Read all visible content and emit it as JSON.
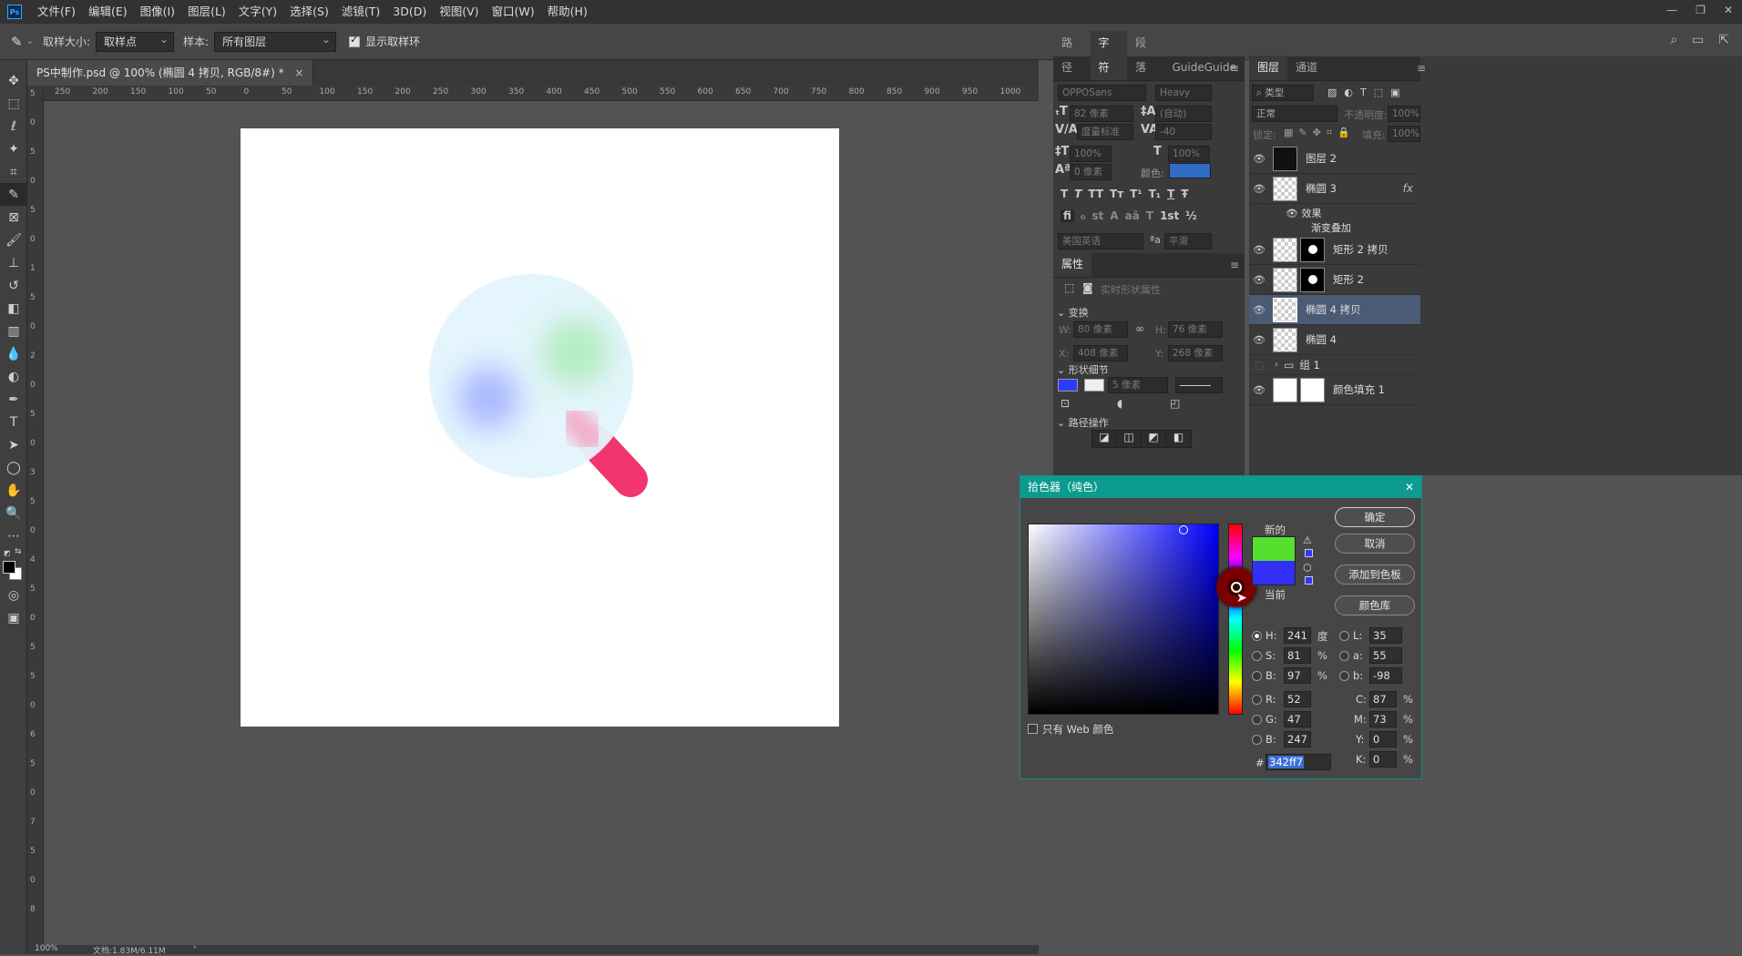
{
  "app": {
    "icon": "Ps"
  },
  "menu": [
    "文件(F)",
    "编辑(E)",
    "图像(I)",
    "图层(L)",
    "文字(Y)",
    "选择(S)",
    "滤镜(T)",
    "3D(D)",
    "视图(V)",
    "窗口(W)",
    "帮助(H)"
  ],
  "options": {
    "sample_size_label": "取样大小:",
    "sample_size_value": "取样点",
    "sample_label": "样本:",
    "sample_value": "所有图层",
    "show_ring_label": "显示取样环"
  },
  "document": {
    "tab_title": "PS中制作.psd @ 100% (椭圆 4 拷贝, RGB/8#) *",
    "close": "×"
  },
  "ruler_h": [
    "250",
    "200",
    "150",
    "100",
    "50",
    "0",
    "50",
    "100",
    "150",
    "200",
    "250",
    "300",
    "350",
    "400",
    "450",
    "500",
    "550",
    "600",
    "650",
    "700",
    "750",
    "800",
    "850",
    "900",
    "950",
    "1000",
    "1050"
  ],
  "ruler_v": [
    "5",
    "0",
    "5",
    "0",
    "5",
    "0",
    "1",
    "5",
    "0",
    "2",
    "0",
    "5",
    "0",
    "3",
    "5",
    "0",
    "4",
    "5",
    "0",
    "5",
    "5",
    "0",
    "6",
    "5",
    "0",
    "7",
    "5",
    "0",
    "8"
  ],
  "status": {
    "zoom": "100%",
    "doc": "文档:1.83M/6.11M",
    "arrow": "›"
  },
  "char_panel": {
    "tabs": [
      "路径",
      "字符",
      "段落",
      "GuideGuide"
    ],
    "font_family": "OPPOSans",
    "font_style": "Heavy",
    "font_size": "82 像素",
    "leading": "(自动)",
    "kerning": "度量标准",
    "tracking": "-40",
    "v_scale": "100%",
    "h_scale": "100%",
    "baseline": "0 像素",
    "color_label": "颜色:",
    "color": "#2f6bc2",
    "style_buttons": [
      "T",
      "T",
      "TT",
      "Tт",
      "T¹",
      "T₁",
      "T",
      "Ŧ"
    ],
    "ot_buttons": [
      "fi",
      "ℴ",
      "st",
      "A",
      "aā",
      "T",
      "1st",
      "½"
    ],
    "language": "美国英语",
    "aa_icon": "ªa",
    "aa_value": "平滑"
  },
  "props_panel": {
    "tab": "属性",
    "header": "实时形状属性",
    "section_transform": "变换",
    "w_label": "W:",
    "w_value": "80 像素",
    "h_label": "H:",
    "h_value": "76 像素",
    "x_label": "X:",
    "x_value": "408 像素",
    "y_label": "Y:",
    "y_value": "268 像素",
    "section_shape": "形状细节",
    "stroke_width": "5 像素",
    "fill_color": "#2b3cff",
    "section_path": "路径操作"
  },
  "layers_panel": {
    "tabs": [
      "图层",
      "通道"
    ],
    "filter": "类型",
    "blend_mode": "正常",
    "opacity_label": "不透明度:",
    "opacity": "100%",
    "lock_label": "锁定:",
    "fill_label": "填充:",
    "fill": "100%",
    "fx": "fx",
    "effects_label": "效果",
    "effect_item": "渐变叠加",
    "layers": [
      "图层 2",
      "椭圆 3",
      "矩形 2 拷贝",
      "矩形 2",
      "椭圆 4 拷贝",
      "椭圆 4",
      "组 1",
      "颜色填充 1"
    ]
  },
  "picker": {
    "title": "拾色器（纯色）",
    "close": "✕",
    "new_label": "新的",
    "current_label": "当前",
    "new_color": "#55e02f",
    "current_color": "#342ff7",
    "buttons": {
      "ok": "确定",
      "cancel": "取消",
      "add_swatch": "添加到色板",
      "libraries": "颜色库"
    },
    "H": "241",
    "S": "81",
    "B": "97",
    "R": "52",
    "G": "47",
    "Bv": "247",
    "L": "35",
    "a": "55",
    "b": "-98",
    "C": "87",
    "M": "73",
    "Y": "0",
    "K": "0",
    "deg": "度",
    "pct": "%",
    "web_only": "只有 Web 颜色",
    "hash": "#",
    "hex": "342ff7",
    "hue_base": "#0000ff"
  }
}
